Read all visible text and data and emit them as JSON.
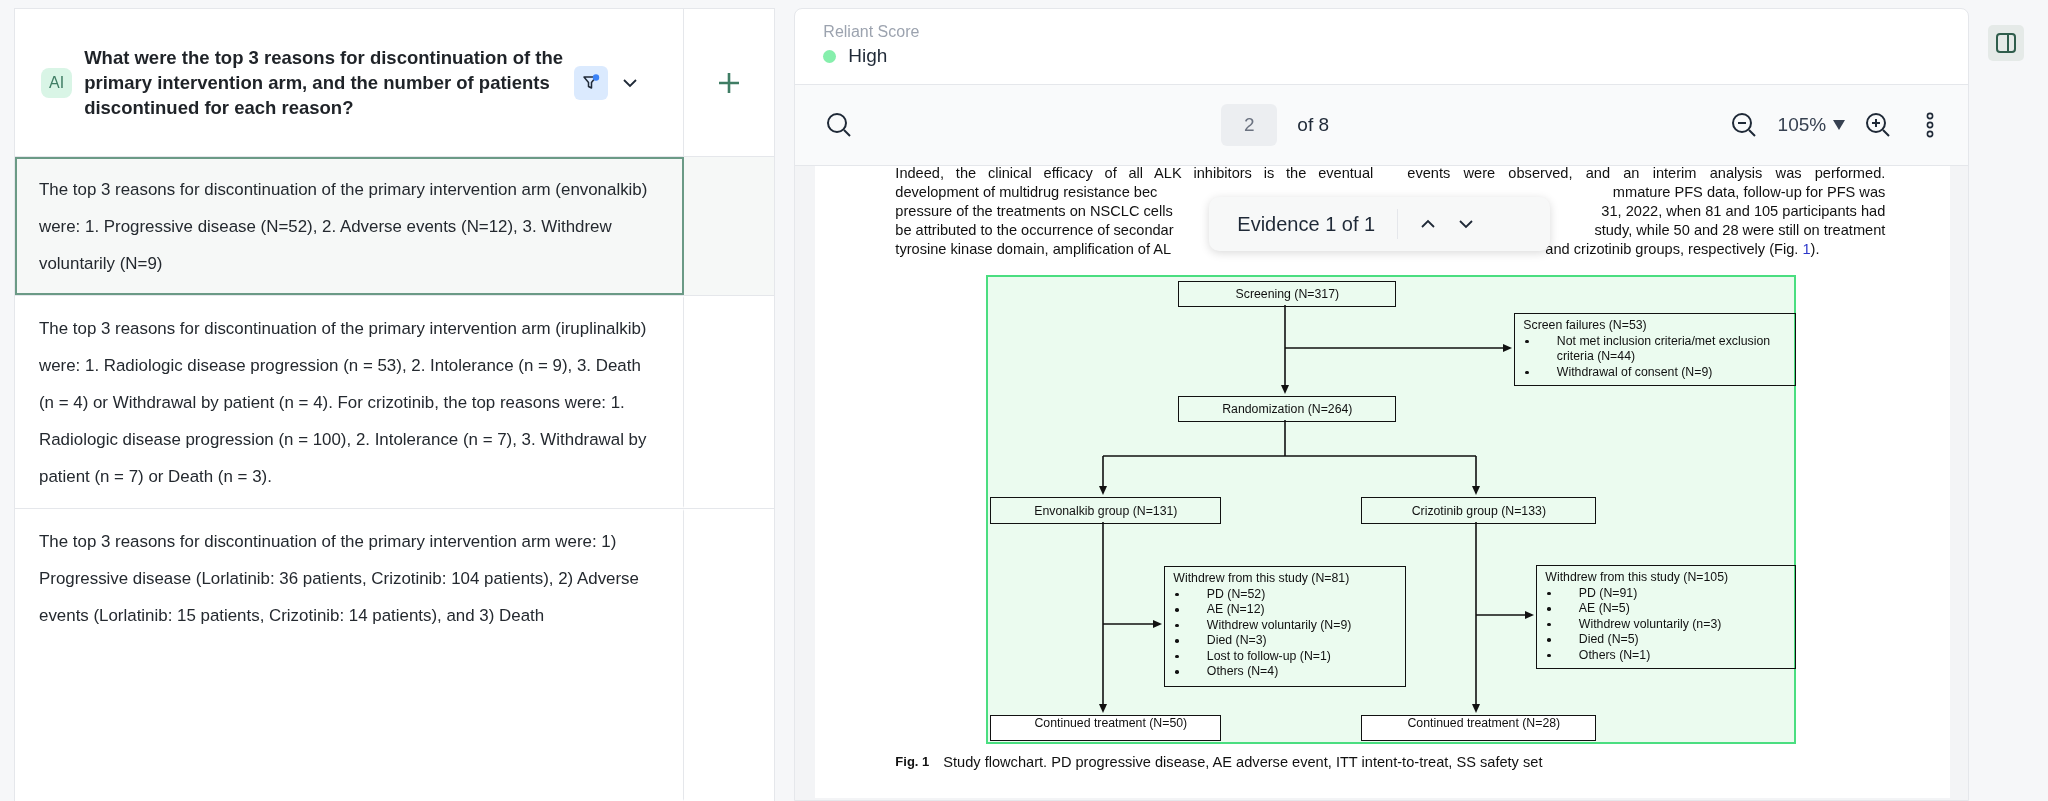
{
  "question": {
    "badge": "AI",
    "text": "What were the top 3 reasons for discontinuation of the primary intervention arm, and the number of patients discontinued for each reason?",
    "filter_active": true
  },
  "answers": [
    {
      "text": "The top 3 reasons for discontinuation of the primary intervention arm (envonalkib) were: 1. Progressive disease (N=52), 2. Adverse events (N=12), 3. Withdrew voluntarily (N=9)",
      "selected": true
    },
    {
      "text": "The top 3 reasons for discontinuation of the primary intervention arm (iruplinalkib) were: 1. Radiologic disease progression (n = 53), 2. Intolerance (n = 9), 3. Death (n = 4) or Withdrawal by patient (n = 4). For crizotinib, the top reasons were: 1. Radiologic disease progression (n = 100), 2. Intolerance (n = 7), 3. Withdrawal by patient (n = 7) or Death (n = 3).",
      "selected": false
    },
    {
      "text": "The top 3 reasons for discontinuation of the primary intervention arm were: 1) Progressive disease (Lorlatinib: 36 patients, Crizotinib: 104 patients), 2) Adverse events (Lorlatinib: 15 patients, Crizotinib: 14 patients), and 3) Death",
      "selected": false
    }
  ],
  "score": {
    "label": "Reliant Score",
    "value": "High",
    "color": "#86efac"
  },
  "toolbar": {
    "page": "2",
    "of": "of 8",
    "zoom": "105%"
  },
  "document": {
    "left_lines": [
      {
        "kind": "full",
        "text": "Indeed, the clinical efficacy of all ALK inhibitors is the eventual"
      },
      {
        "kind": "left",
        "text": "development of multidrug resistance bec"
      },
      {
        "kind": "left",
        "text": "pressure of the treatments on NSCLC cells"
      },
      {
        "kind": "left",
        "text": "be attributed to the occurrence of secondar"
      },
      {
        "kind": "left",
        "text": "tyrosine kinase domain, amplification of AL"
      }
    ],
    "right_lines": [
      {
        "kind": "full",
        "text": "events were observed, and an interim analysis was performed."
      },
      {
        "kind": "right",
        "text": "mmature PFS data, follow-up for PFS was"
      },
      {
        "kind": "right",
        "text": "31, 2022, when 81 and 105 participants had"
      },
      {
        "kind": "right",
        "text": "study, while 50 and 28 were still on treatment"
      },
      {
        "kind": "link",
        "text": "and crizotinib groups, respectively (Fig. ",
        "link": "1",
        "after": ")."
      }
    ],
    "evidence": {
      "text": "Evidence 1 of 1"
    },
    "flowchart": [
      {
        "kind": "center",
        "title": "Screening (N=317)"
      },
      {
        "kind": "list",
        "title": "Screen failures (N=53)",
        "items": [
          "Not met inclusion criteria/met exclusion criteria (N=44)",
          "Withdrawal of consent (N=9)"
        ]
      },
      {
        "kind": "center",
        "title": "Randomization (N=264)"
      },
      {
        "kind": "center",
        "title": "Envonalkib group (N=131)"
      },
      {
        "kind": "center",
        "title": "Crizotinib group (N=133)"
      },
      {
        "kind": "list",
        "title": "Withdrew from this study (N=81)",
        "items": [
          "PD (N=52)",
          "AE (N=12)",
          "Withdrew voluntarily (N=9)",
          "Died (N=3)",
          "Lost to follow-up (N=1)",
          "Others (N=4)"
        ]
      },
      {
        "kind": "list",
        "title": "Withdrew from this study (N=105)",
        "items": [
          "PD (N=91)",
          "AE (N=5)",
          "Withdrew voluntarily (n=3)",
          "Died (N=5)",
          "Others (N=1)"
        ]
      },
      {
        "kind": "left",
        "title": "Continued treatment (N=50)"
      },
      {
        "kind": "left",
        "title": "Continued treatment (N=28)"
      }
    ],
    "caption": {
      "label": "Fig. 1",
      "text": "Study flowchart. PD progressive disease, AE adverse event, ITT intent-to-treat, SS safety set"
    }
  }
}
